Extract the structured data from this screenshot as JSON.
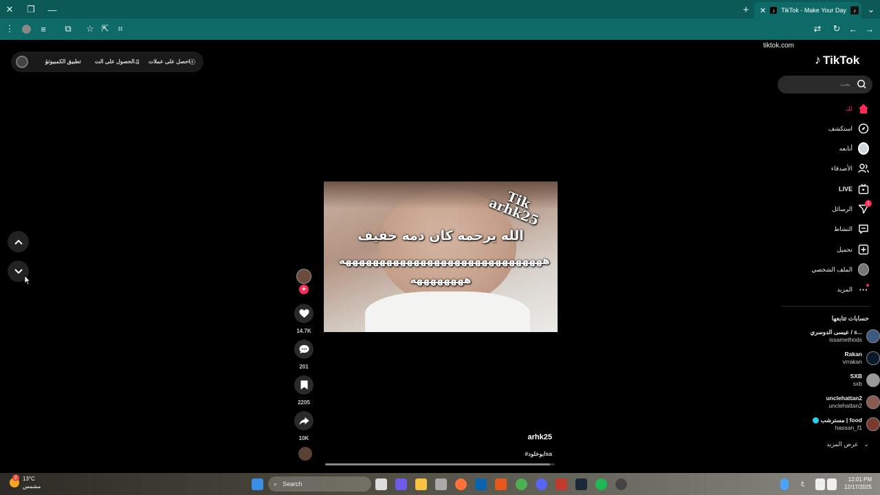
{
  "browser": {
    "tab_title": "TikTok - Make Your Day",
    "url": "tiktok.com"
  },
  "top_bar": {
    "get_coins": "احصل على عملات",
    "get_app": "الحصول على الت...",
    "pc_app": "تطبيق الكمبيوتر"
  },
  "sidebar": {
    "logo": "TikTok",
    "search_placeholder": "بحث",
    "nav": [
      {
        "label": "لك",
        "icon": "home-icon"
      },
      {
        "label": "استكشف",
        "icon": "explore-icon"
      },
      {
        "label": "أتابعه",
        "icon": "following-icon"
      },
      {
        "label": "الأصدقاء",
        "icon": "friends-icon"
      },
      {
        "label": "LIVE",
        "icon": "live-icon"
      },
      {
        "label": "الرسائل",
        "icon": "messages-icon",
        "badge": "1"
      },
      {
        "label": "النشاط",
        "icon": "activity-icon"
      },
      {
        "label": "تحميل",
        "icon": "upload-icon"
      },
      {
        "label": "الملف الشخصي",
        "icon": "profile-icon"
      },
      {
        "label": "المزيد",
        "icon": "more-icon"
      }
    ],
    "following_title": "حسابات تتابعها",
    "following": [
      {
        "name": "عيسى الدوسري / s...",
        "user": "issamethods"
      },
      {
        "name": "Rakan",
        "user": "vrrakan"
      },
      {
        "name": "SXB",
        "user": "sxb"
      },
      {
        "name": "unclehattan2",
        "user": "unclehattan2"
      },
      {
        "name": "مسترشب | food",
        "user": "hassan_f1"
      }
    ],
    "see_more": "عرض المزيد"
  },
  "video": {
    "watermark_line1": "Tik",
    "watermark_line2": "arhk25",
    "caption_line1": "الله يرحمه كان دمه خفيف",
    "caption_line2": "ههههههههههههههههههههههههههههههه ههههههههه",
    "author": "arhk25",
    "hashtag": "#ابوخلودsa",
    "progress": 0.98
  },
  "actions": {
    "likes": "14.7K",
    "comments": "201",
    "saves": "2205",
    "shares": "10K"
  },
  "taskbar": {
    "weather_temp": "13°C",
    "weather_desc": "مشمس",
    "weather_badge": "2",
    "search": "Search",
    "time": "12:01 PM",
    "date": "12/17/2025",
    "lang": "ع"
  }
}
